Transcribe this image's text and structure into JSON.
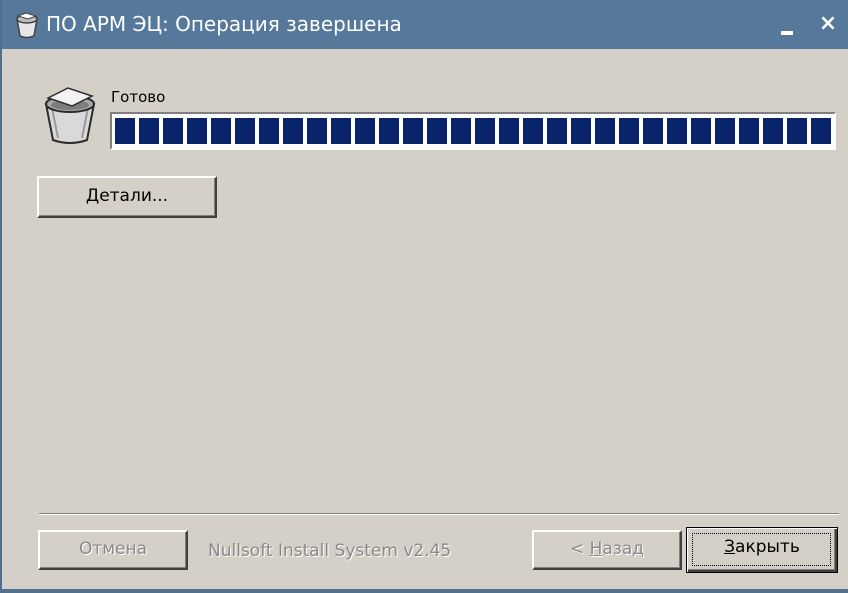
{
  "window": {
    "title": "ПО АРМ ЭЦ: Операция завершена",
    "minimize_glyph": "_",
    "close_glyph": "×"
  },
  "status": {
    "label": "Готово",
    "progress_fraction": 1.0
  },
  "details_button": {
    "prefix": "",
    "accel": "Д",
    "rest": "етали..."
  },
  "footer": {
    "cancel_label": "Отмена",
    "branding": "Nullsoft Install System v2.45",
    "back_prefix": "< ",
    "back_accel": "Н",
    "back_rest": "азад",
    "close_accel": "З",
    "close_rest": "акрыть"
  },
  "colors": {
    "titlebar": "#56799b",
    "dialog_face": "#d4d0c8",
    "progress_block": "#0a246a",
    "disabled_text": "#8a8a8a"
  },
  "icons": {
    "title": "recycle-bin-icon",
    "header": "recycle-bin-icon"
  }
}
